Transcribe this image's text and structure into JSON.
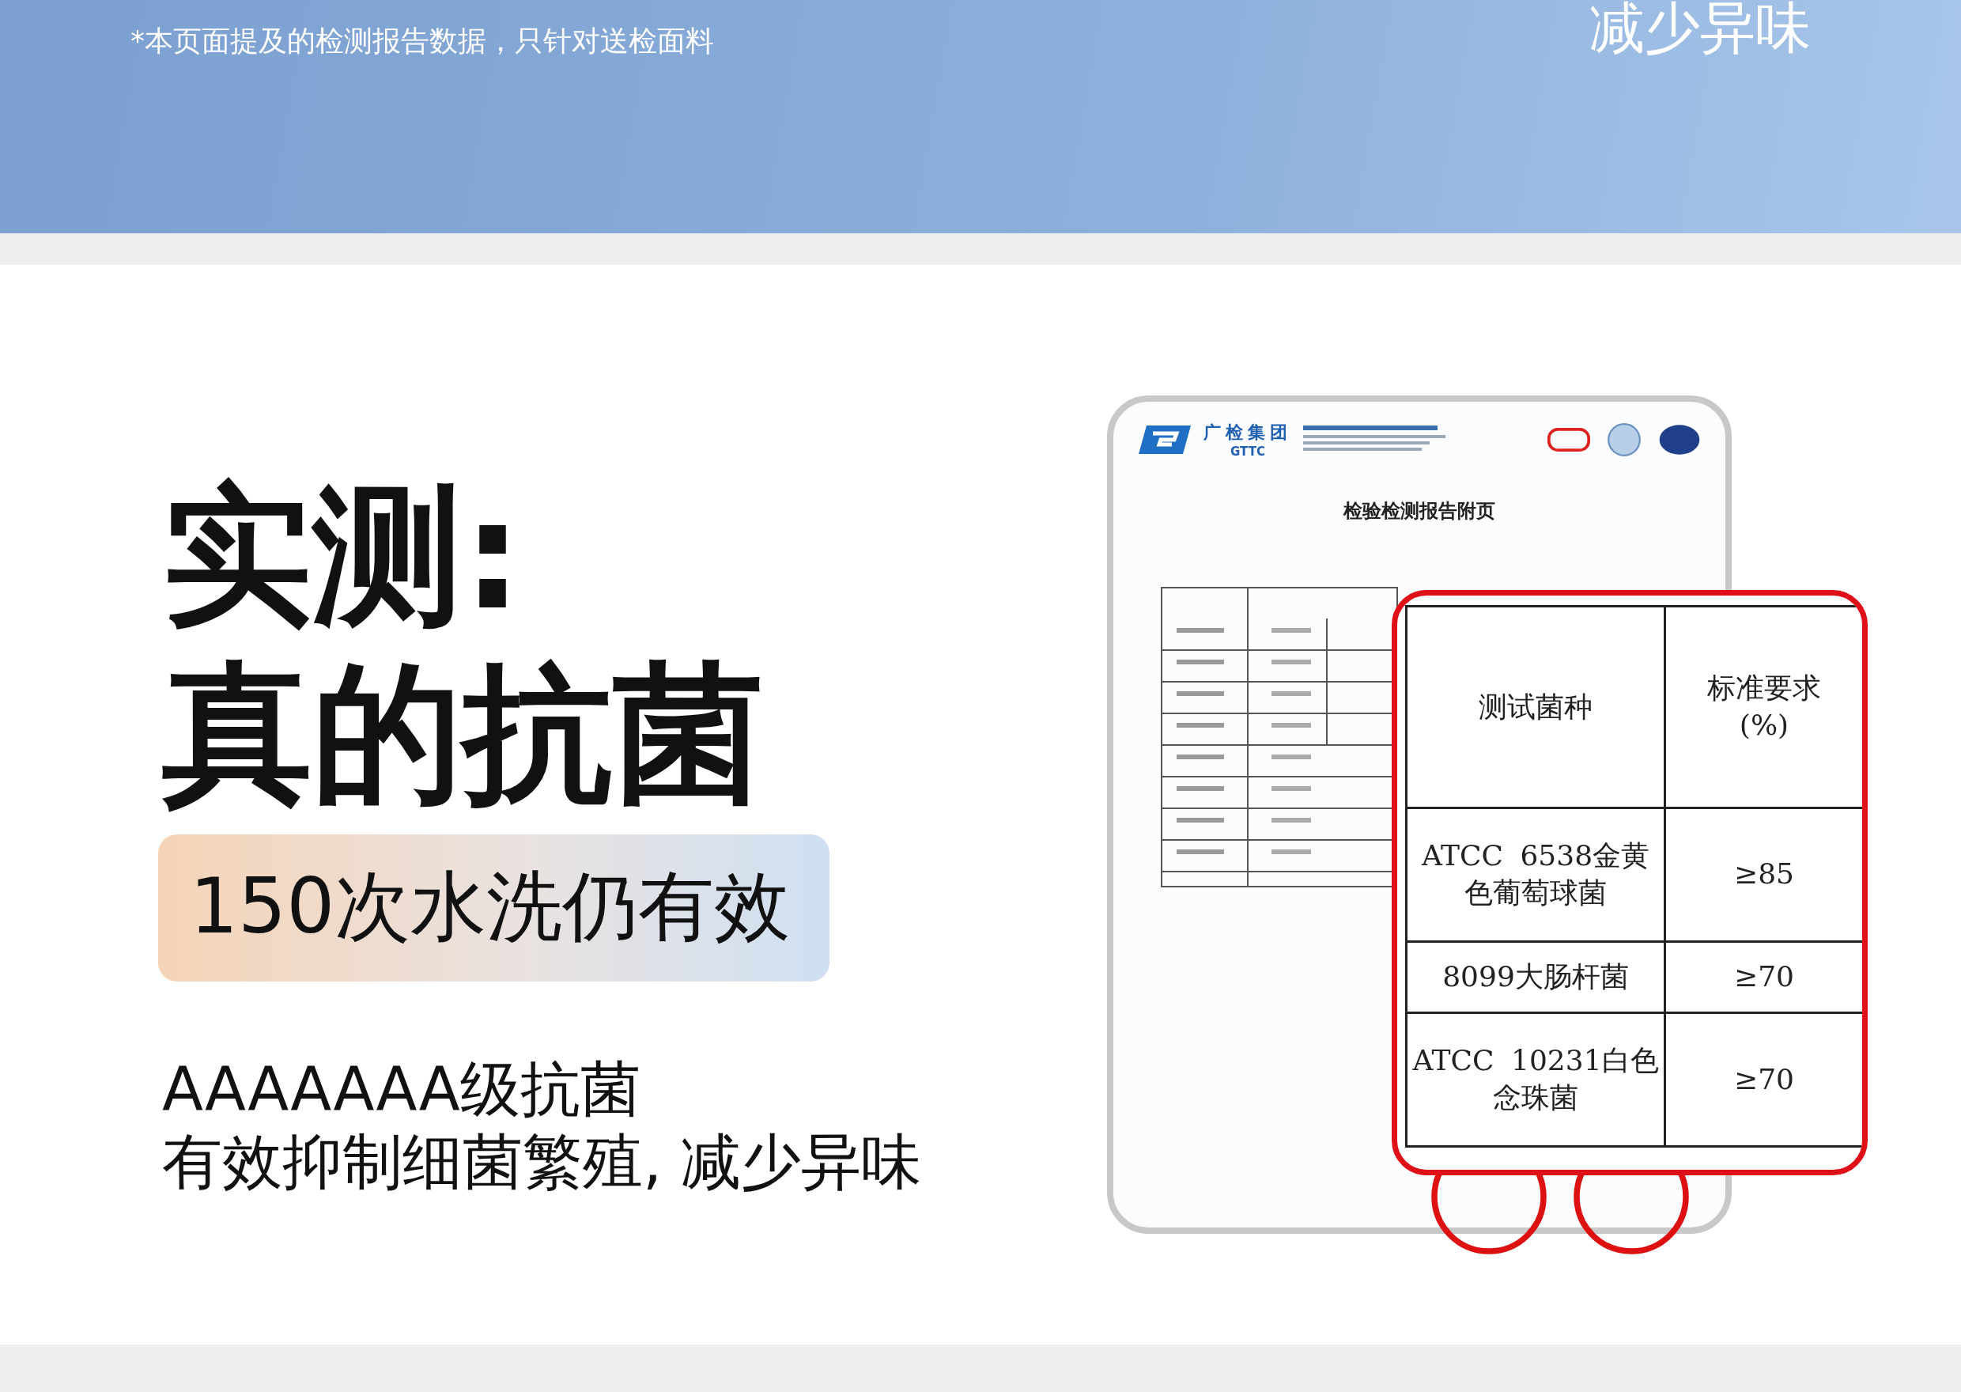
{
  "banner": {
    "note": "*本页面提及的检测报告数据，只针对送检面料",
    "caption": "减少异味"
  },
  "headline": [
    "实测:",
    "真的抗菌"
  ],
  "badge": "150次水洗仍有效",
  "grade": "AAAAAAA级抗菌",
  "description": "有效抑制细菌繁殖, 减少异味",
  "report": {
    "org_name": "广检集团",
    "org_abbr": "GTTC",
    "title": "检验检测报告附页",
    "zoom_table": {
      "columns": [
        "测试菌种",
        "标准要求\n(%)"
      ],
      "rows": [
        [
          "ATCC 6538金黄色葡萄球菌",
          "≥85"
        ],
        [
          "8099大肠杆菌",
          "≥70"
        ],
        [
          "ATCC 10231白色念珠菌",
          "≥70"
        ]
      ]
    }
  }
}
